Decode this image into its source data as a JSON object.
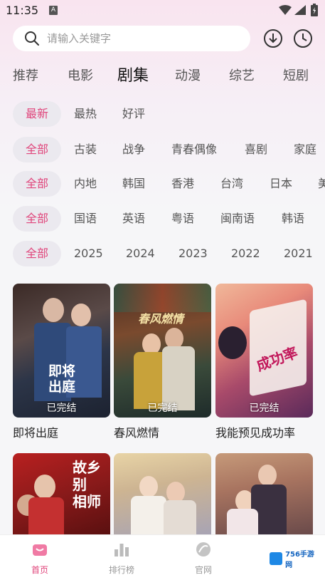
{
  "status_bar": {
    "time": "11:35",
    "notification_letter": "A"
  },
  "search": {
    "placeholder": "请输入关键字"
  },
  "tabs": [
    {
      "label": "推荐",
      "active": false
    },
    {
      "label": "电影",
      "active": false
    },
    {
      "label": "剧集",
      "active": true
    },
    {
      "label": "动漫",
      "active": false
    },
    {
      "label": "综艺",
      "active": false
    },
    {
      "label": "短剧",
      "active": false
    }
  ],
  "filters": {
    "sort": [
      "最新",
      "最热",
      "好评"
    ],
    "genre": [
      "全部",
      "古装",
      "战争",
      "青春偶像",
      "喜剧",
      "家庭"
    ],
    "region": [
      "全部",
      "内地",
      "韩国",
      "香港",
      "台湾",
      "日本",
      "美"
    ],
    "language": [
      "全部",
      "国语",
      "英语",
      "粤语",
      "闽南语",
      "韩语"
    ],
    "year": [
      "全部",
      "2025",
      "2024",
      "2023",
      "2022",
      "2021"
    ]
  },
  "accent_color": "#e0457b",
  "posters": [
    {
      "title": "即将出庭",
      "status": "已完结",
      "art_text": "即将出庭"
    },
    {
      "title": "春风燃情",
      "status": "已完结",
      "art_text": "春风燃情"
    },
    {
      "title": "我能预见成功率",
      "status": "已完结",
      "art_text": "成功率"
    },
    {
      "title": "",
      "status": "",
      "art_text": "故乡别 相师"
    },
    {
      "title": "",
      "status": "",
      "art_text": ""
    },
    {
      "title": "",
      "status": "",
      "art_text": ""
    }
  ],
  "bottom_nav": [
    {
      "label": "首页",
      "icon": "home-icon",
      "active": true
    },
    {
      "label": "排行榜",
      "icon": "ranking-icon",
      "active": false
    },
    {
      "label": "官网",
      "icon": "website-icon",
      "active": false
    }
  ],
  "watermark": {
    "text": "756手游网"
  }
}
